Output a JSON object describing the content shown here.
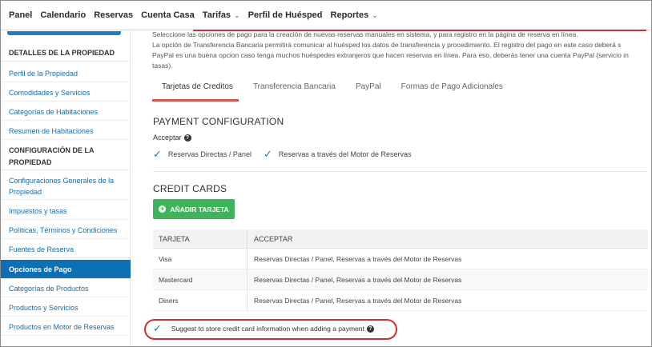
{
  "nav": {
    "items": [
      {
        "label": "Panel",
        "dropdown": false
      },
      {
        "label": "Calendario",
        "dropdown": false
      },
      {
        "label": "Reservas",
        "dropdown": false
      },
      {
        "label": "Cuenta Casa",
        "dropdown": false
      },
      {
        "label": "Tarifas",
        "dropdown": true
      },
      {
        "label": "Perfil de Huésped",
        "dropdown": false
      },
      {
        "label": "Reportes",
        "dropdown": true
      }
    ]
  },
  "sidebar": {
    "section1": "DETALLES DE LA PROPIEDAD",
    "items1": [
      "Perfil de la Propiedad",
      "Comodidades y Servicios",
      "Categorías de Habitaciones",
      "Resumen de Habitaciones"
    ],
    "section2": "CONFIGURACIÓN DE LA PROPIEDAD",
    "items2": [
      "Configuraciones Generales de la Propiedad",
      "Impuestos y tasas",
      "Políticas, Términos y Condiciones",
      "Fuentes de Reserva",
      "Opciones de Pago",
      "Categorías de Productos",
      "Productos y Servicios",
      "Productos en Motor de Reservas"
    ],
    "active": "Opciones de Pago"
  },
  "main": {
    "description": [
      "Seleccione las opciones de pago para la creación de nuevas reservas manuales en sistema, y para registro en la página de reserva en línea.",
      "La opción de Transferencia Bancaria permitirá comunicar al huésped los datos de transferencia y procedimiento. El registro del pago en este caso deberá s",
      "PayPal es una buena opcion caso tenga muchos huéspedes extranjeros que hacen reservas en línea. Para eso, deberás tener una cuenta PayPal (servicio in",
      "tasas)."
    ],
    "tabs": [
      "Tarjetas de Creditos",
      "Transferencia Bancaria",
      "PayPal",
      "Formas de Pago Adicionales"
    ],
    "active_tab": "Tarjetas de Creditos",
    "payment_config_title": "PAYMENT CONFIGURATION",
    "accept_label": "Acceptar",
    "accept_options": [
      "Reservas Directas / Panel",
      "Reservas a través del Motor de Reservas"
    ],
    "credit_cards_title": "CREDIT CARDS",
    "add_card_label": "AÑADIR TARJETA",
    "table": {
      "headers": [
        "TARJETA",
        "ACCEPTAR"
      ],
      "rows": [
        [
          "Visa",
          "Reservas Directas / Panel, Reservas a través del Motor de Reservas"
        ],
        [
          "Mastercard",
          "Reservas Directas / Panel, Reservas a través del Motor de Reservas"
        ],
        [
          "Diners",
          "Reservas Directas / Panel, Reservas a través del Motor de Reservas"
        ]
      ]
    },
    "suggest_label": "Suggest to store credit card information when adding a payment"
  },
  "colors": {
    "accent_blue": "#0e6fb3",
    "link_blue": "#1a6aa8",
    "tab_underline": "#d9534f",
    "add_button": "#3db35a",
    "highlight_ellipse": "#d32f2f"
  }
}
